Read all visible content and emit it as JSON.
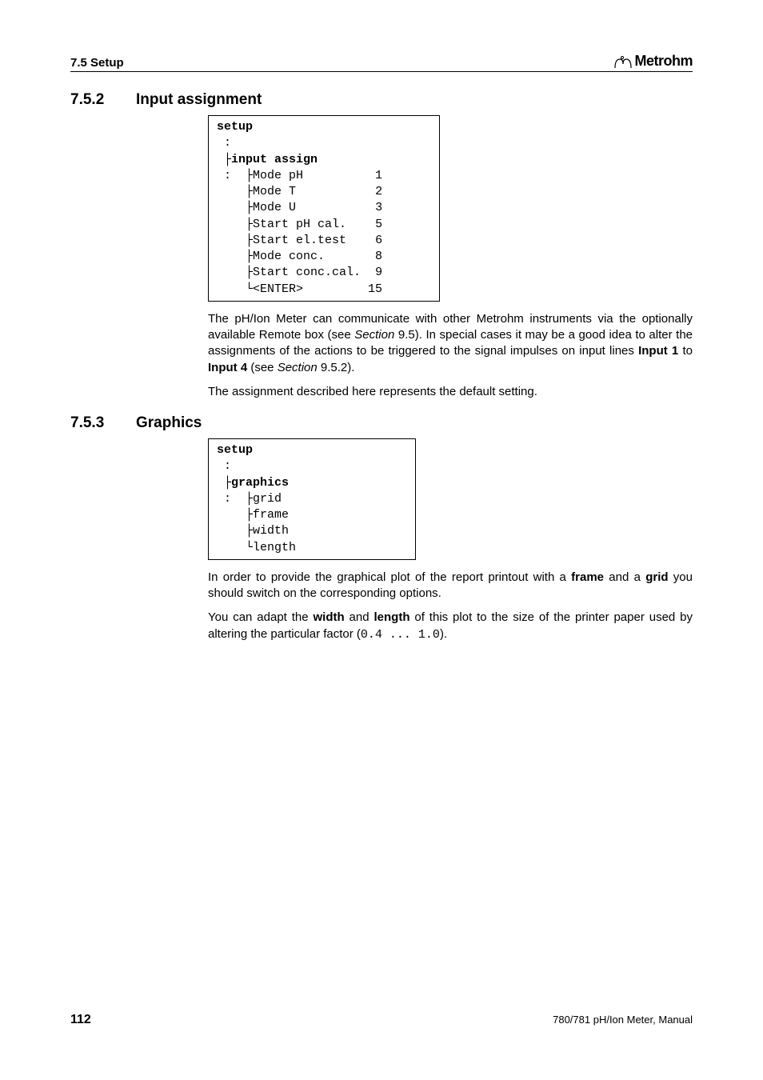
{
  "header": {
    "section_ref": "7.5 Setup",
    "brand": "Metrohm"
  },
  "sections": [
    {
      "number": "7.5.2",
      "title": "Input assignment"
    },
    {
      "number": "7.5.3",
      "title": "Graphics"
    }
  ],
  "codebox1": {
    "header": "setup",
    "group": "input assign",
    "rows": [
      {
        "label": "Mode pH",
        "val": "1"
      },
      {
        "label": "Mode T",
        "val": "2"
      },
      {
        "label": "Mode U",
        "val": "3"
      },
      {
        "label": "Start pH cal.",
        "val": "5"
      },
      {
        "label": "Start el.test",
        "val": "6"
      },
      {
        "label": "Mode conc.",
        "val": "8"
      },
      {
        "label": "Start conc.cal.",
        "val": "9"
      },
      {
        "label": "<ENTER>",
        "val": "15"
      }
    ]
  },
  "para1_parts": {
    "p1": "The pH/Ion Meter can communicate with other Metrohm instruments via the optionally available Remote box (see ",
    "p2": "Section",
    "p3": " 9.5). In special cases it may be a good idea to alter the assignments of the actions to be triggered to the signal impulses on input lines ",
    "p4": "Input 1",
    "p5": " to ",
    "p6": "Input 4",
    "p7": " (see ",
    "p8": "Section",
    "p9": " 9.5.2)."
  },
  "para2": "The assignment described here represents the default setting.",
  "codebox2": {
    "header": "setup",
    "group": "graphics",
    "rows": [
      "grid",
      "frame",
      "width",
      "length"
    ]
  },
  "para3_parts": {
    "p1": "In order to provide the graphical plot of the report printout with a ",
    "p2": "frame",
    "p3": " and a ",
    "p4": "grid",
    "p5": " you should switch on the corresponding options."
  },
  "para4_parts": {
    "p1": "You can adapt the ",
    "p2": "width",
    "p3": " and ",
    "p4": "length",
    "p5": " of this plot to the size of the printer paper used by altering the particular factor (",
    "p6": "0.4 ... 1.0",
    "p7": ")."
  },
  "footer": {
    "page_number": "112",
    "doc_ref": "780/781 pH/Ion Meter, Manual"
  }
}
